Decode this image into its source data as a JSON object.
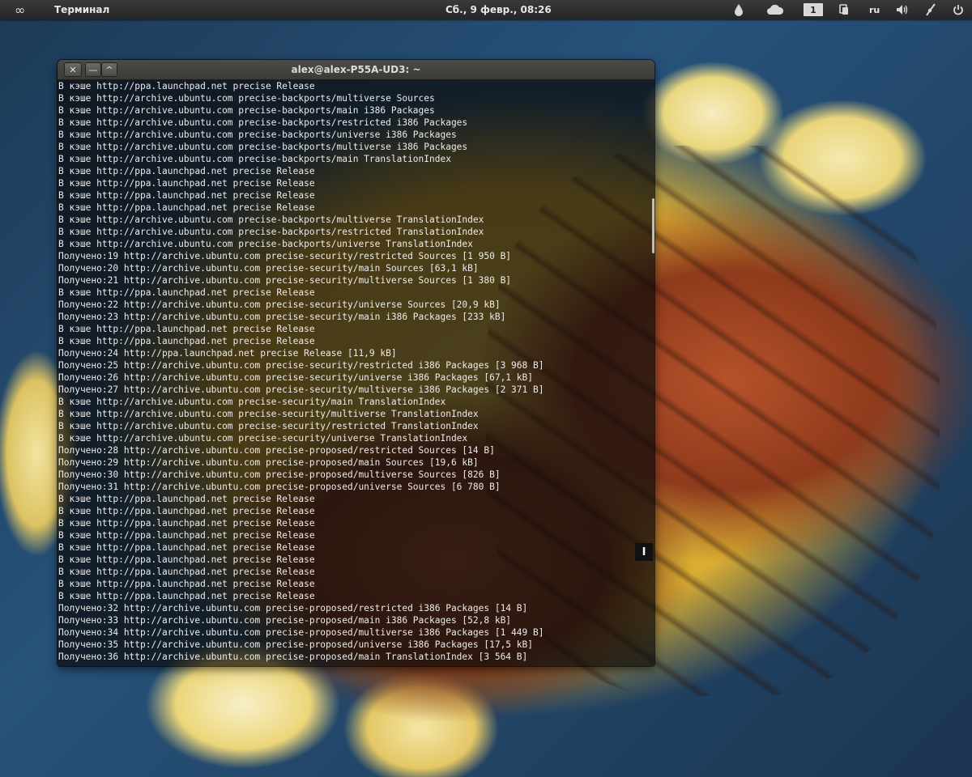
{
  "panel": {
    "app_name": "Терминал",
    "clock": "Сб., 9 февр., 08:26",
    "workspace": "1",
    "keyboard_layout": "ru",
    "icons": {
      "launcher": "infinity-icon",
      "drop": "drop-icon",
      "cloud": "cloud-icon",
      "copy": "copy-icon",
      "volume": "volume-icon",
      "network": "network-icon",
      "power": "power-icon"
    }
  },
  "window": {
    "title": "alex@alex-P55A-UD3: ~",
    "buttons": {
      "close": "✕",
      "minimize": "—",
      "maximize": "^"
    }
  },
  "terminal": {
    "lines": [
      "В кэше http://ppa.launchpad.net precise Release",
      "В кэше http://archive.ubuntu.com precise-backports/multiverse Sources",
      "В кэше http://archive.ubuntu.com precise-backports/main i386 Packages",
      "В кэше http://archive.ubuntu.com precise-backports/restricted i386 Packages",
      "В кэше http://archive.ubuntu.com precise-backports/universe i386 Packages",
      "В кэше http://archive.ubuntu.com precise-backports/multiverse i386 Packages",
      "В кэше http://archive.ubuntu.com precise-backports/main TranslationIndex",
      "В кэше http://ppa.launchpad.net precise Release",
      "В кэше http://ppa.launchpad.net precise Release",
      "В кэше http://ppa.launchpad.net precise Release",
      "В кэше http://ppa.launchpad.net precise Release",
      "В кэше http://archive.ubuntu.com precise-backports/multiverse TranslationIndex",
      "В кэше http://archive.ubuntu.com precise-backports/restricted TranslationIndex",
      "В кэше http://archive.ubuntu.com precise-backports/universe TranslationIndex",
      "Получено:19 http://archive.ubuntu.com precise-security/restricted Sources [1 950 B]",
      "Получено:20 http://archive.ubuntu.com precise-security/main Sources [63,1 kB]",
      "Получено:21 http://archive.ubuntu.com precise-security/multiverse Sources [1 380 B]",
      "В кэше http://ppa.launchpad.net precise Release",
      "Получено:22 http://archive.ubuntu.com precise-security/universe Sources [20,9 kB]",
      "Получено:23 http://archive.ubuntu.com precise-security/main i386 Packages [233 kB]",
      "В кэше http://ppa.launchpad.net precise Release",
      "В кэше http://ppa.launchpad.net precise Release",
      "Получено:24 http://ppa.launchpad.net precise Release [11,9 kB]",
      "Получено:25 http://archive.ubuntu.com precise-security/restricted i386 Packages [3 968 B]",
      "Получено:26 http://archive.ubuntu.com precise-security/universe i386 Packages [67,1 kB]",
      "Получено:27 http://archive.ubuntu.com precise-security/multiverse i386 Packages [2 371 B]",
      "В кэше http://archive.ubuntu.com precise-security/main TranslationIndex",
      "В кэше http://archive.ubuntu.com precise-security/multiverse TranslationIndex",
      "В кэше http://archive.ubuntu.com precise-security/restricted TranslationIndex",
      "В кэше http://archive.ubuntu.com precise-security/universe TranslationIndex",
      "Получено:28 http://archive.ubuntu.com precise-proposed/restricted Sources [14 B]",
      "Получено:29 http://archive.ubuntu.com precise-proposed/main Sources [19,6 kB]",
      "Получено:30 http://archive.ubuntu.com precise-proposed/multiverse Sources [826 B]",
      "Получено:31 http://archive.ubuntu.com precise-proposed/universe Sources [6 780 B]",
      "В кэше http://ppa.launchpad.net precise Release",
      "В кэше http://ppa.launchpad.net precise Release",
      "В кэше http://ppa.launchpad.net precise Release",
      "В кэше http://ppa.launchpad.net precise Release",
      "В кэше http://ppa.launchpad.net precise Release",
      "В кэше http://ppa.launchpad.net precise Release",
      "В кэше http://ppa.launchpad.net precise Release",
      "В кэше http://ppa.launchpad.net precise Release",
      "В кэше http://ppa.launchpad.net precise Release",
      "Получено:32 http://archive.ubuntu.com precise-proposed/restricted i386 Packages [14 B]",
      "Получено:33 http://archive.ubuntu.com precise-proposed/main i386 Packages [52,8 kB]",
      "Получено:34 http://archive.ubuntu.com precise-proposed/multiverse i386 Packages [1 449 B]",
      "Получено:35 http://archive.ubuntu.com precise-proposed/universe i386 Packages [17,5 kB]",
      "Получено:36 http://archive.ubuntu.com precise-proposed/main TranslationIndex [3 564 B]"
    ]
  },
  "colors": {
    "terminal_text": "#ececec",
    "panel_bg": "#2e2e2e",
    "titlebar_bg": "#3f3f3c"
  }
}
